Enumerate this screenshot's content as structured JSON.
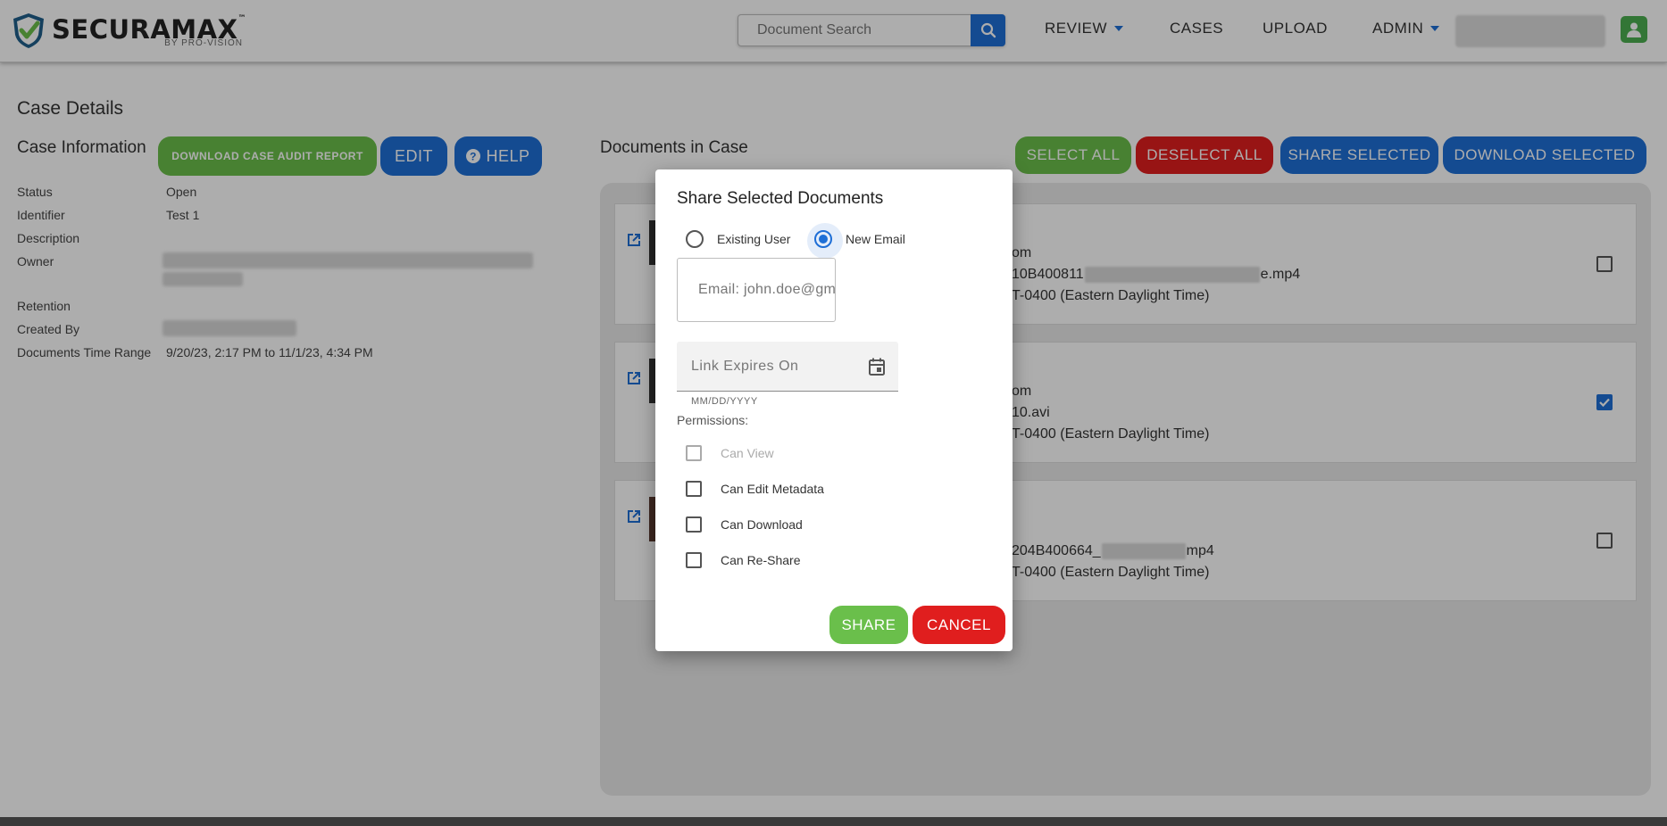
{
  "brand": {
    "name": "SECURAMAX",
    "tm": "™",
    "sub": "BY PRO-VISION"
  },
  "search": {
    "placeholder": "Document Search"
  },
  "nav": {
    "review": "REVIEW",
    "cases": "CASES",
    "upload": "UPLOAD",
    "admin": "ADMIN"
  },
  "page": {
    "title": "Case Details",
    "section": "Case Information"
  },
  "actions": {
    "audit_report": "DOWNLOAD CASE AUDIT REPORT",
    "edit": "EDIT",
    "help": "HELP"
  },
  "case_info": {
    "status_label": "Status",
    "status_value": "Open",
    "identifier_label": "Identifier",
    "identifier_value": "Test 1",
    "description_label": "Description",
    "owner_label": "Owner",
    "retention_label": "Retention",
    "created_by_label": "Created By",
    "time_range_label": "Documents Time Range",
    "time_range_value": "9/20/23, 2:17 PM to 11/1/23, 4:34 PM"
  },
  "documents": {
    "title": "Documents in Case",
    "select_all": "SELECT ALL",
    "deselect_all": "DESELECT ALL",
    "share_selected": "SHARE SELECTED",
    "download_selected": "DOWNLOAD SELECTED",
    "items": [
      {
        "line1": "om",
        "line2a": "10B400811",
        "line2b": "e.mp4",
        "line3": "T-0400 (Eastern Daylight Time)",
        "checked": false
      },
      {
        "line1": "om",
        "line2a": "10.avi",
        "line2b": "",
        "line3": "T-0400 (Eastern Daylight Time)",
        "checked": true
      },
      {
        "line1": "",
        "line2a": "204B400664_",
        "line2b": "mp4",
        "line3": "T-0400 (Eastern Daylight Time)",
        "checked": false
      }
    ]
  },
  "modal": {
    "title": "Share Selected Documents",
    "existing_user": "Existing User",
    "new_email": "New Email",
    "email_placeholder": "Email: john.doe@gmail.com",
    "link_expires_placeholder": "Link Expires On",
    "date_hint": "MM/DD/YYYY",
    "permissions_label": "Permissions:",
    "perm_view": "Can View",
    "perm_edit": "Can Edit Metadata",
    "perm_download": "Can Download",
    "perm_reshare": "Can Re-Share",
    "share": "SHARE",
    "cancel": "CANCEL"
  },
  "colors": {
    "blue": "#1e6fd6",
    "green": "#6abf4b",
    "red": "#e01e1e"
  }
}
